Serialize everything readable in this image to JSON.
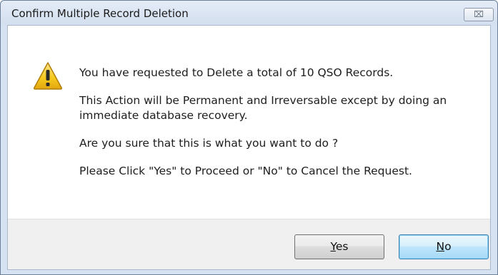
{
  "window": {
    "title": "Confirm Multiple Record Deletion",
    "close_glyph": "⌧"
  },
  "icon": "warning-triangle-icon",
  "messages": [
    "You have requested to Delete a total of 10 QSO Records.",
    "This Action will be Permanent and Irreversable except by doing an immediate database recovery.",
    "Are you sure that this is what you want to do ?",
    "Please Click \"Yes\" to Proceed or \"No\" to Cancel the Request."
  ],
  "buttons": {
    "yes_label": "Yes",
    "no_label": "No"
  },
  "colors": {
    "title_bar": "#d6e2f1",
    "warning_fill": "#f6c81c",
    "default_button_border": "#3c7fb1"
  }
}
